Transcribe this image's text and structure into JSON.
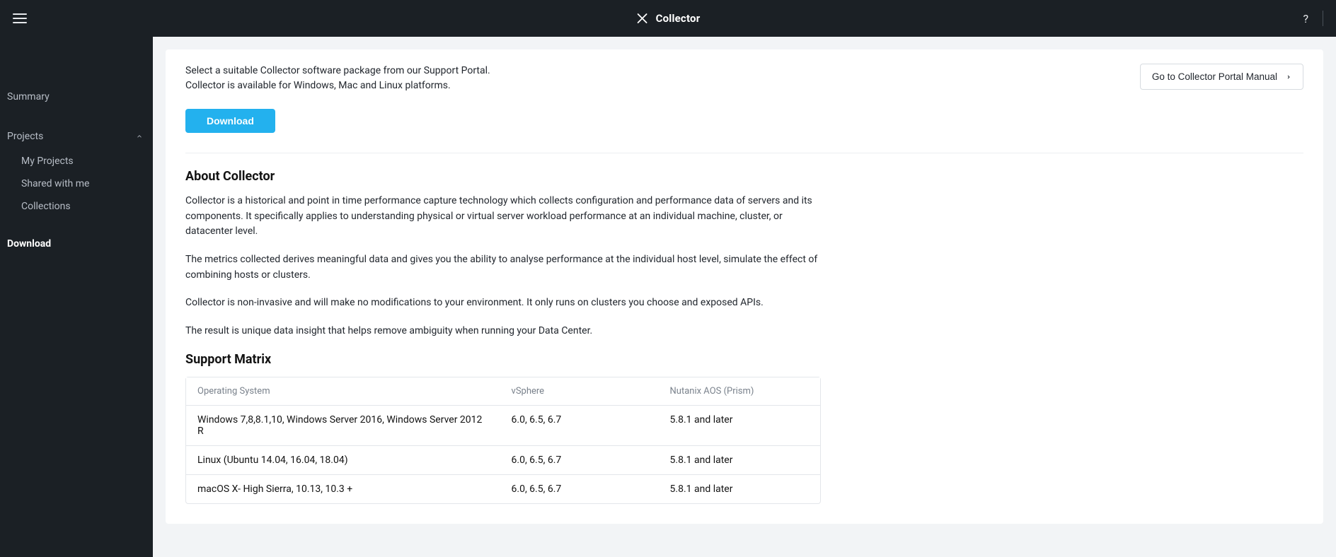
{
  "header": {
    "app_name": "Collector",
    "help_label": "?"
  },
  "sidebar": {
    "summary": "Summary",
    "projects": "Projects",
    "subs": {
      "my_projects": "My Projects",
      "shared_with_me": "Shared with me",
      "collections": "Collections"
    },
    "download": "Download"
  },
  "main": {
    "intro_line1": "Select a suitable Collector software package from our Support Portal.",
    "intro_line2": "Collector is available for Windows, Mac and Linux platforms.",
    "manual_btn": "Go to Collector Portal Manual",
    "download_btn": "Download",
    "about_heading": "About Collector",
    "about_p1": "Collector is a historical and point in time performance capture technology which collects configuration and performance data of servers and its components. It specifically applies to understanding physical or virtual server workload performance at an individual machine, cluster, or datacenter level.",
    "about_p2": "The metrics collected derives meaningful data and gives you the ability to analyse performance at the individual host level, simulate the effect of combining hosts or clusters.",
    "about_p3": "Collector is non-invasive and will make no modifications to your environment. It only runs on clusters you choose and exposed APIs.",
    "about_p4": "The result is unique data insight that helps remove ambiguity when running your Data Center.",
    "matrix_heading": "Support Matrix",
    "matrix": {
      "headers": {
        "os": "Operating System",
        "vsphere": "vSphere",
        "aos": "Nutanix AOS (Prism)"
      },
      "rows": [
        {
          "os": "Windows 7,8,8.1,10, Windows Server 2016, Windows Server 2012 R",
          "vsphere": "6.0, 6.5, 6.7",
          "aos": "5.8.1 and later"
        },
        {
          "os": "Linux (Ubuntu 14.04, 16.04, 18.04)",
          "vsphere": "6.0, 6.5, 6.7",
          "aos": "5.8.1 and later"
        },
        {
          "os": "macOS X- High Sierra, 10.13, 10.3 +",
          "vsphere": "6.0, 6.5, 6.7",
          "aos": "5.8.1 and later"
        }
      ]
    }
  }
}
